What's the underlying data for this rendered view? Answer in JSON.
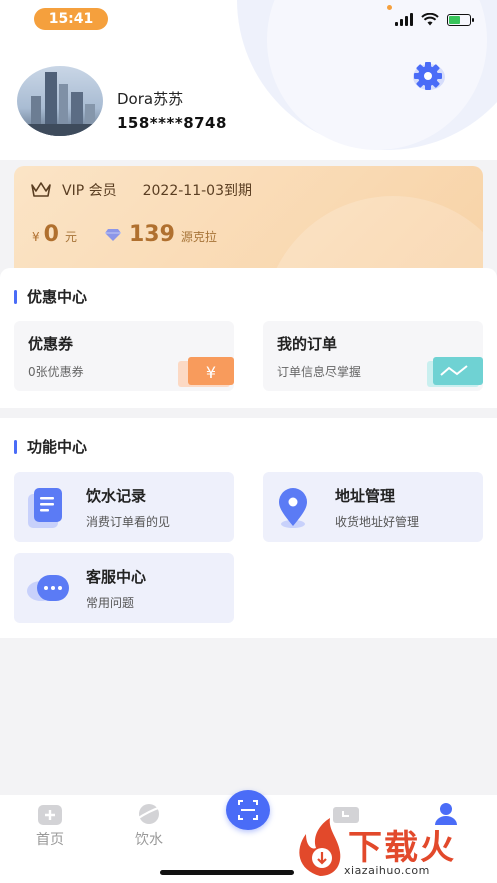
{
  "status_bar": {
    "time": "15:41"
  },
  "profile": {
    "name": "Dora苏苏",
    "phone": "158****8748"
  },
  "vip": {
    "label": "VIP 会员",
    "expiry": "2022-11-03到期",
    "balance_symbol": "¥",
    "balance": "0",
    "balance_unit": "元",
    "points": "139",
    "points_unit": "源克拉"
  },
  "discount_section": {
    "title": "优惠中心",
    "cards": [
      {
        "title": "优惠券",
        "subtitle": "0张优惠券"
      },
      {
        "title": "我的订单",
        "subtitle": "订单信息尽掌握"
      }
    ]
  },
  "function_section": {
    "title": "功能中心",
    "cards": [
      {
        "title": "饮水记录",
        "subtitle": "消费订单看的见"
      },
      {
        "title": "地址管理",
        "subtitle": "收货地址好管理"
      },
      {
        "title": "客服中心",
        "subtitle": "常用问题"
      }
    ]
  },
  "tabbar": {
    "items": [
      {
        "label": "首页"
      },
      {
        "label": "饮水"
      },
      {
        "label": ""
      },
      {
        "label": ""
      },
      {
        "label": ""
      }
    ]
  },
  "watermark": {
    "text": "下载火",
    "url": "xiazaihuo.com"
  },
  "colors": {
    "accent": "#4a6cf7",
    "vip_gold": "#b0702f",
    "time_pill": "#f5a03d"
  }
}
